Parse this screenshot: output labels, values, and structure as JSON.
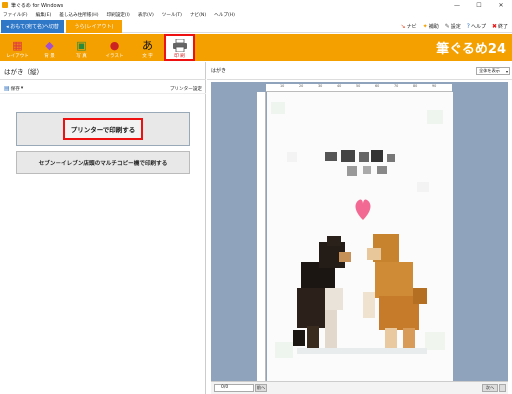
{
  "window": {
    "title": "筆ぐるめ for Windows",
    "minimize": "—",
    "maximize": "☐",
    "close": "✕"
  },
  "menu": [
    "ファイル(F)",
    "編集(E)",
    "差し込み住所帳(H)",
    "印刷設定(I)",
    "表示(V)",
    "ツール(T)",
    "ナビ(N)",
    "ヘルプ(H)"
  ],
  "tabs": {
    "front": "◂ おもて(宛て名)へ切替",
    "back": "うら(レイアウト)"
  },
  "right_tools": [
    {
      "icon": "navi-icon",
      "glyph": "↘",
      "color": "#e53",
      "label": "ナビ"
    },
    {
      "icon": "hint-icon",
      "glyph": "✦",
      "color": "#f3a000",
      "label": "補助"
    },
    {
      "icon": "settings-icon",
      "glyph": "✎",
      "color": "#555",
      "label": "設定"
    },
    {
      "icon": "help-icon",
      "glyph": "?",
      "color": "#2d6fc0",
      "label": "ヘルプ"
    },
    {
      "icon": "exit-icon",
      "glyph": "✖",
      "color": "#e11",
      "label": "終了"
    }
  ],
  "ribbon": {
    "buttons": [
      {
        "id": "layout",
        "label": "レイアウト",
        "icon": "layout-icon",
        "glyph": "▦",
        "color": "#d34"
      },
      {
        "id": "background",
        "label": "背 景",
        "icon": "background-icon",
        "glyph": "◆",
        "color": "#a34fd0"
      },
      {
        "id": "photo",
        "label": "写 真",
        "icon": "photo-icon",
        "glyph": "▣",
        "color": "#2a8a3a"
      },
      {
        "id": "illust",
        "label": "イラスト",
        "icon": "illust-icon",
        "glyph": "●",
        "color": "#c22"
      },
      {
        "id": "text",
        "label": "文 字",
        "icon": "text-icon",
        "glyph": "あ",
        "color": "#111"
      },
      {
        "id": "print",
        "label": "印 刷",
        "icon": "printer-icon",
        "glyph": "▬",
        "color": "#444"
      }
    ],
    "brand": "筆ぐるめ24"
  },
  "left_panel": {
    "title": "はがき（縦）",
    "save_label": "保存",
    "save_arrow": "▾",
    "printer_setup": "プリンター設定",
    "print_button": "プリンターで印刷する",
    "seven_button": "セブン－イレブン店頭のマルチコピー機で印刷する"
  },
  "right_panel": {
    "title": "はがき",
    "view_select": "全体を表示",
    "ruler_ticks": [
      "10",
      "20",
      "30",
      "40",
      "50",
      "60",
      "70",
      "80",
      "90"
    ]
  },
  "bottom": {
    "page": "0/0",
    "prev": "前へ",
    "next": "次へ"
  }
}
